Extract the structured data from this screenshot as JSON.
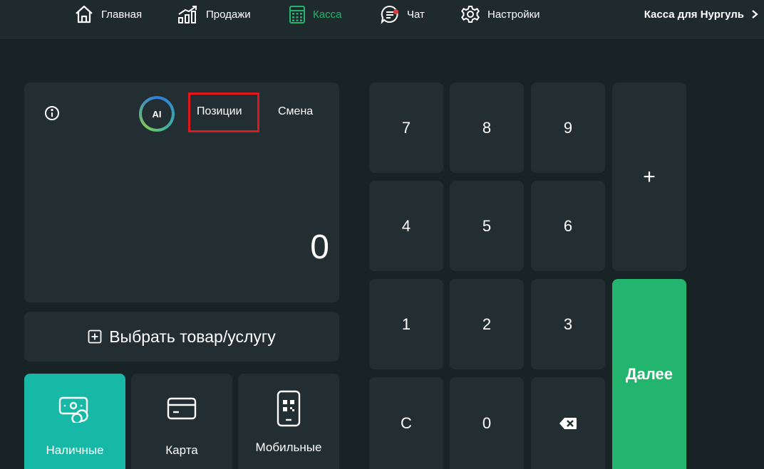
{
  "nav": {
    "items": [
      {
        "label": "Главная",
        "icon": "home-icon"
      },
      {
        "label": "Продажи",
        "icon": "sales-chart-icon"
      },
      {
        "label": "Касса",
        "icon": "calculator-icon",
        "active": true
      },
      {
        "label": "Чат",
        "icon": "chat-icon",
        "has_notification": true
      },
      {
        "label": "Настройки",
        "icon": "gear-icon"
      }
    ],
    "store_name": "Касса для Нургуль"
  },
  "display": {
    "ai_label": "AI",
    "tabs": [
      "Позиции",
      "Смена"
    ],
    "amount": "0"
  },
  "pick_button": {
    "label": "Выбрать товар/услугу"
  },
  "payment_methods": [
    {
      "label": "Наличные",
      "icon": "cash-icon",
      "selected": true
    },
    {
      "label": "Карта",
      "icon": "card-icon"
    },
    {
      "label": "Мобильные",
      "icon": "mobile-qr-icon"
    }
  ],
  "keypad": {
    "keys": [
      "7",
      "8",
      "9",
      "4",
      "5",
      "6",
      "1",
      "2",
      "3",
      "C",
      "0"
    ],
    "backspace_icon": "backspace-icon",
    "plus": "+",
    "next": "Далее"
  },
  "colors": {
    "background": "#182325",
    "panel": "#222e31",
    "accent_green": "#23b46d",
    "accent_teal": "#17b8a6",
    "highlight_red": "#e0181e"
  }
}
